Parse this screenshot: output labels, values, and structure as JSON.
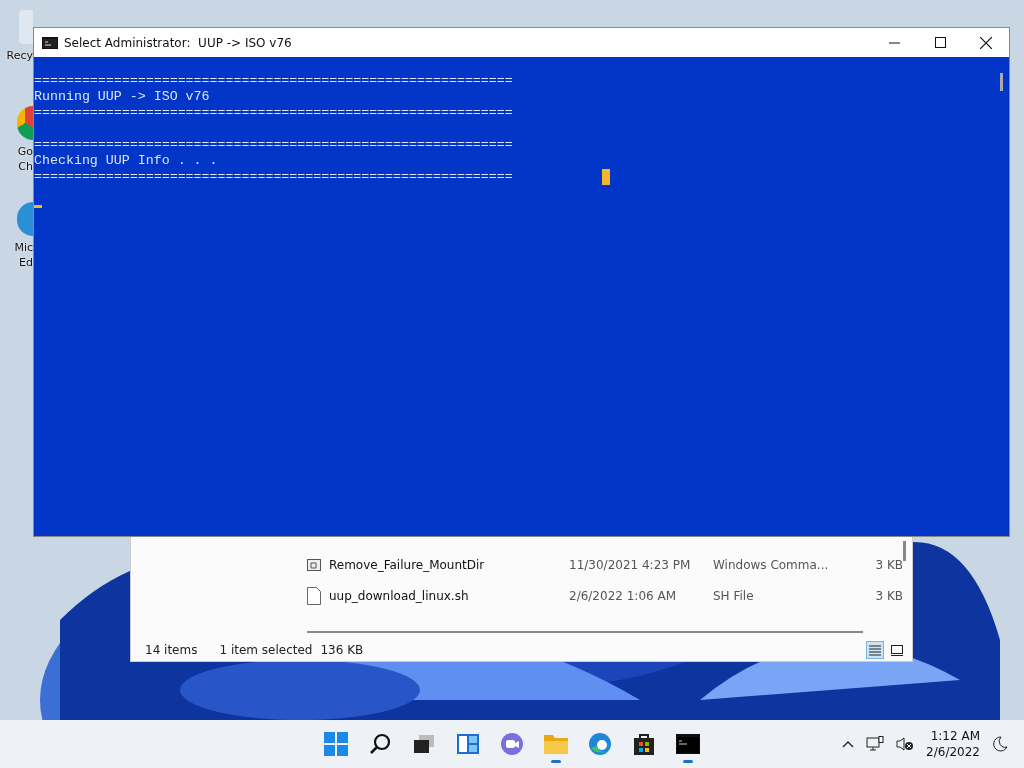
{
  "desktop_icons": [
    {
      "lines": [
        "Recy"
      ]
    },
    {
      "lines": [
        "Go",
        "Ch"
      ]
    },
    {
      "lines": [
        "Mic",
        "Ed"
      ]
    }
  ],
  "console": {
    "title": "Select Administrator:  UUP -> ISO v76",
    "lines": [
      {
        "kind": "text",
        "text": "============================================================"
      },
      {
        "kind": "text",
        "text": "Running UUP -> ISO v76"
      },
      {
        "kind": "text",
        "text": "============================================================"
      },
      {
        "kind": "blank"
      },
      {
        "kind": "text",
        "text": "============================================================"
      },
      {
        "kind": "text",
        "text": "Checking UUP Info . . ."
      },
      {
        "kind": "text",
        "text": "============================================================"
      }
    ]
  },
  "explorer": {
    "rows": [
      {
        "kind": "cmd",
        "name": "Remove_Failure_MountDir",
        "date": "11/30/2021 4:23 PM",
        "type": "Windows Comma...",
        "size": "3 KB"
      },
      {
        "kind": "file",
        "name": "uup_download_linux.sh",
        "date": "2/6/2022 1:06 AM",
        "type": "SH File",
        "size": "3 KB"
      }
    ],
    "status": {
      "count": "14 items",
      "selection": "1 item selected",
      "size": "136 KB"
    },
    "views": [
      {
        "kind": "details",
        "selected": true
      },
      {
        "kind": "tiles",
        "selected": false
      }
    ]
  },
  "taskbar": {
    "apps": [
      {
        "kind": "start",
        "running": false
      },
      {
        "kind": "search",
        "running": false
      },
      {
        "kind": "taskview",
        "running": false
      },
      {
        "kind": "widgets",
        "running": false
      },
      {
        "kind": "chat",
        "running": false
      },
      {
        "kind": "explorer",
        "running": true
      },
      {
        "kind": "edge",
        "running": false
      },
      {
        "kind": "store",
        "running": false
      },
      {
        "kind": "terminal",
        "running": true
      }
    ],
    "time": "1:12 AM",
    "date": "2/6/2022"
  }
}
